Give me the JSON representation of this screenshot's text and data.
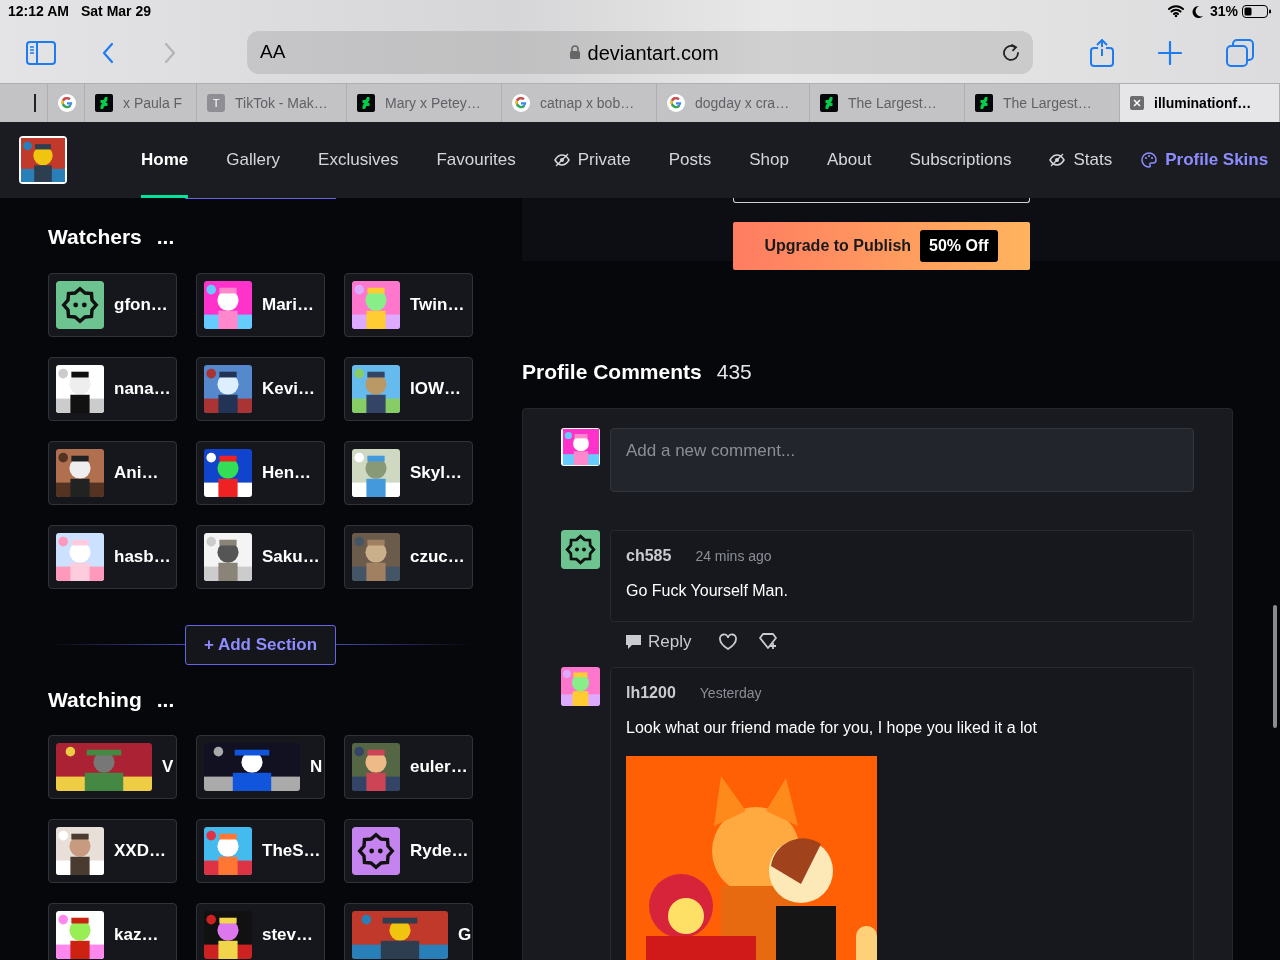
{
  "status_bar": {
    "time": "12:12 AM",
    "date": "Sat Mar 29",
    "battery_text": "31%"
  },
  "toolbar": {
    "text_size": "AA",
    "url": "deviantart.com",
    "forward_disabled": true
  },
  "browser_tabs": [
    {
      "kind": "stub",
      "selected": false
    },
    {
      "kind": "google",
      "selected": false
    },
    {
      "kind": "deviantart",
      "label": "x Paula F",
      "selected": false
    },
    {
      "kind": "letter",
      "letter": "T",
      "label": "TikTok - Mak…",
      "selected": false
    },
    {
      "kind": "deviantart",
      "label": "Mary x Petey…",
      "selected": false
    },
    {
      "kind": "google",
      "label": "catnap x bob…",
      "selected": false
    },
    {
      "kind": "google",
      "label": "dogday x cra…",
      "selected": false
    },
    {
      "kind": "deviantart",
      "label": "The Largest…",
      "selected": false
    },
    {
      "kind": "deviantart",
      "label": "The Largest…",
      "selected": false
    },
    {
      "kind": "close",
      "label": "illuminationf…",
      "selected": true
    }
  ],
  "nav": {
    "items": [
      {
        "kind": "plain",
        "label": "Home",
        "selected": true
      },
      {
        "kind": "plain",
        "label": "Gallery",
        "selected": false
      },
      {
        "kind": "plain",
        "label": "Exclusives",
        "selected": false
      },
      {
        "kind": "plain",
        "label": "Favourites",
        "selected": false
      },
      {
        "kind": "eye",
        "label": "Private",
        "selected": false
      },
      {
        "kind": "plain",
        "label": "Posts",
        "selected": false
      },
      {
        "kind": "plain",
        "label": "Shop",
        "selected": false
      },
      {
        "kind": "plain",
        "label": "About",
        "selected": false
      },
      {
        "kind": "plain",
        "label": "Subscriptions",
        "selected": false
      },
      {
        "kind": "eye",
        "label": "Stats",
        "selected": false
      },
      {
        "kind": "skins",
        "label": "Profile Skins",
        "selected": false
      }
    ]
  },
  "upgrade": {
    "label": "Upgrade to Publish",
    "badge": "50% Off"
  },
  "add_section_label": "+ Add Section",
  "watchers": {
    "title": "Watchers",
    "more": "...",
    "users": [
      {
        "name": "gfon…",
        "avatar": {
          "kind": "default",
          "color": "#6ec490"
        }
      },
      {
        "name": "Mari…"
      },
      {
        "name": "Twin…"
      },
      {
        "name": "nana…"
      },
      {
        "name": "Kevi…"
      },
      {
        "name": "IOW…"
      },
      {
        "name": "Ani…"
      },
      {
        "name": "Hen…"
      },
      {
        "name": "Skyl…"
      },
      {
        "name": "hasb…"
      },
      {
        "name": "Saku…"
      },
      {
        "name": "czuc…"
      }
    ]
  },
  "watching": {
    "title": "Watching",
    "more": "...",
    "users": [
      {
        "name": "V",
        "avatar": {
          "kind": "wide_picture"
        }
      },
      {
        "name": "N",
        "avatar": {
          "kind": "wide_picture"
        }
      },
      {
        "name": "euler…"
      },
      {
        "name": "XXD…"
      },
      {
        "name": "TheS…"
      },
      {
        "name": "Ryde…",
        "avatar": {
          "kind": "default",
          "color": "#c483ee"
        }
      },
      {
        "name": "kaz…"
      },
      {
        "name": "stev…"
      },
      {
        "name": "G",
        "avatar": {
          "kind": "wide_picture"
        }
      }
    ]
  },
  "profile_comments": {
    "title": "Profile Comments",
    "count": "435",
    "placeholder": "Add a new comment...",
    "comments": [
      {
        "user": "ch585",
        "avatar": {
          "kind": "default",
          "color": "#6ec490"
        },
        "time": "24 mins ago",
        "text": "Go Fuck Yourself Man.",
        "reply": "Reply",
        "attachment": false
      },
      {
        "user": "lh1200",
        "time": "Yesterday",
        "text": "Look what our friend made for you, I hope you liked it a lot",
        "attachment": true
      }
    ]
  }
}
